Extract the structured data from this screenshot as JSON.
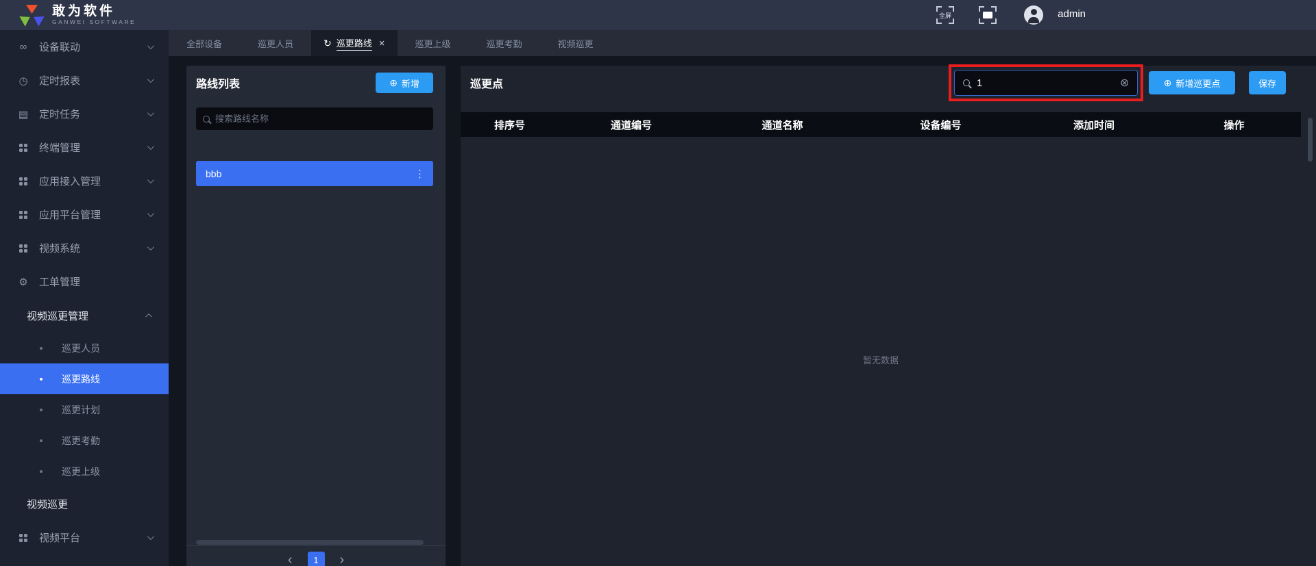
{
  "header": {
    "brand": {
      "title": "敢为软件",
      "subtitle": "GANWEI SOFTWARE"
    },
    "fullscreen_label": "全屏",
    "username": "admin"
  },
  "sidebar": {
    "items": [
      {
        "label": "设备联动",
        "icon": "device-linkage-icon",
        "chevron": "down"
      },
      {
        "label": "定时报表",
        "icon": "timer-report-icon",
        "chevron": "down"
      },
      {
        "label": "定时任务",
        "icon": "timer-task-icon",
        "chevron": "down"
      },
      {
        "label": "终端管理",
        "icon": "grid-icon",
        "chevron": "down"
      },
      {
        "label": "应用接入管理",
        "icon": "grid-icon",
        "chevron": "down"
      },
      {
        "label": "应用平台管理",
        "icon": "grid-icon",
        "chevron": "down"
      },
      {
        "label": "视频系统",
        "icon": "grid-icon",
        "chevron": "down"
      },
      {
        "label": "工单管理",
        "icon": "gear-icon",
        "chevron": null
      },
      {
        "label": "视频巡更管理",
        "group": true,
        "chevron": "up"
      },
      {
        "label": "巡更人员",
        "sub": true
      },
      {
        "label": "巡更路线",
        "sub": true,
        "active": true
      },
      {
        "label": "巡更计划",
        "sub": true
      },
      {
        "label": "巡更考勤",
        "sub": true
      },
      {
        "label": "巡更上级",
        "sub": true
      },
      {
        "label": "视频巡更",
        "group": true
      },
      {
        "label": "视频平台",
        "icon": "grid-icon",
        "chevron": "down"
      }
    ]
  },
  "tabs": {
    "items": [
      {
        "label": "全部设备"
      },
      {
        "label": "巡更人员"
      },
      {
        "label": "巡更路线",
        "active": true,
        "refresh": true,
        "closable": true
      },
      {
        "label": "巡更上级"
      },
      {
        "label": "巡更考勤"
      },
      {
        "label": "视频巡更"
      }
    ]
  },
  "route_panel": {
    "title": "路线列表",
    "add_button": "新增",
    "search_placeholder": "搜索路线名称",
    "routes": [
      {
        "name": "bbb",
        "selected": true
      }
    ],
    "pagination": {
      "prev": "‹",
      "current": "1",
      "next": "›"
    }
  },
  "patrol_panel": {
    "title": "巡更点",
    "search_value": "1",
    "add_button": "新增巡更点",
    "save_button": "保存",
    "table": {
      "columns": [
        "排序号",
        "通道编号",
        "通道名称",
        "设备编号",
        "添加时间",
        "操作"
      ],
      "rows": [],
      "empty_text": "暂无数据"
    }
  },
  "colors": {
    "accent_blue": "#2b9bf3",
    "selection_blue": "#3a6ff2",
    "annotation_red": "#e81d1d",
    "header_bg": "#2f3548",
    "sidebar_bg": "#1d2230",
    "page_bg": "#12161f",
    "card_bg_left": "#252a37",
    "card_bg_right": "#1e232e",
    "table_header_bg": "#0a0d13"
  }
}
